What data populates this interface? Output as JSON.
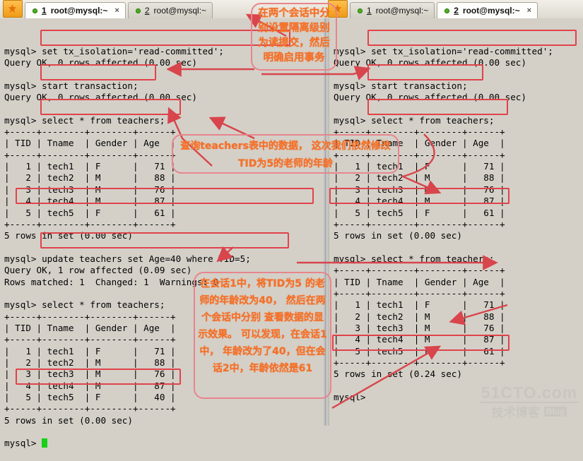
{
  "window": {
    "app_icon": "terminal-star-icon"
  },
  "tabs_left": [
    {
      "num": "1",
      "label": "root@mysql:~",
      "active": true,
      "close": "×"
    },
    {
      "num": "2",
      "label": "root@mysql:~",
      "active": false,
      "close": ""
    }
  ],
  "tabs_right": [
    {
      "num": "1",
      "label": "root@mysql:~",
      "active": false,
      "close": ""
    },
    {
      "num": "2",
      "label": "root@mysql:~",
      "active": true,
      "close": "×"
    }
  ],
  "session1": {
    "title": "session-1-terminal",
    "text": "mysql> set tx_isolation='read-committed';\nQuery OK, 0 rows affected (0.00 sec)\n\nmysql> start transaction;\nQuery OK, 0 rows affected (0.00 sec)\n\nmysql> select * from teachers;\n+-----+--------+--------+------+\n| TID | Tname  | Gender | Age  |\n+-----+--------+--------+------+\n|   1 | tech1  | F      |   71 |\n|   2 | tech2  | M      |   88 |\n|   3 | tech3  | M      |   76 |\n|   4 | tech4  | M      |   87 |\n|   5 | tech5  | F      |   61 |\n+-----+--------+--------+------+\n5 rows in set (0.00 sec)\n\nmysql> update teachers set Age=40 where TID=5;\nQuery OK, 1 row affected (0.09 sec)\nRows matched: 1  Changed: 1  Warnings: 0\n\nmysql> select * from teachers;\n+-----+--------+--------+------+\n| TID | Tname  | Gender | Age  |\n+-----+--------+--------+------+\n|   1 | tech1  | F      |   71 |\n|   2 | tech2  | M      |   88 |\n|   3 | tech3  | M      |   76 |\n|   4 | tech4  | M      |   87 |\n|   5 | tech5  | F      |   40 |\n+-----+--------+--------+------+\n5 rows in set (0.00 sec)\n\nmysql> ",
    "prompt_cursor": "green-block-cursor"
  },
  "session2": {
    "title": "session-2-terminal",
    "text": "mysql> set tx_isolation='read-committed';\nQuery OK, 0 rows affected (0.00 sec)\n\nmysql> start transaction;\nQuery OK, 0 rows affected (0.00 sec)\n\nmysql> select * from teachers;\n+-----+--------+--------+------+\n| TID | Tname  | Gender | Age  |\n+-----+--------+--------+------+\n|   1 | tech1  | F      |   71 |\n|   2 | tech2  | M      |   88 |\n|   3 | tech3  | M      |   76 |\n|   4 | tech4  | M      |   87 |\n|   5 | tech5  | F      |   61 |\n+-----+--------+--------+------+\n5 rows in set (0.00 sec)\n\nmysql> select * from teachers;\n+-----+--------+--------+------+\n| TID | Tname  | Gender | Age  |\n+-----+--------+--------+------+\n|   1 | tech1  | F      |   71 |\n|   2 | tech2  | M      |   88 |\n|   3 | tech3  | M      |   76 |\n|   4 | tech4  | M      |   87 |\n|   5 | tech5  | F      |   61 |\n+-----+--------+--------+------+\n5 rows in set (0.24 sec)\n\nmysql>"
  },
  "annotations": {
    "note1": "在两个会话中分\n别设置隔离级别\n为读提交，然后\n明确启用事务",
    "note2": "查询teachers表中的数据，\n这次我们依然修改TID为5的老师的年龄",
    "note3": "在会话1中，将TID为5\n的老师的年龄改为40，\n然后在两个会话中分别\n查看数据的显示效果。\n可以发现，在会话1中，\n年龄改为了40，但在会\n话2中，年龄依然是61",
    "highlight_color": "#e0434a",
    "note_text_color": "#f3712a"
  },
  "watermark": {
    "line1": "51CTO.com",
    "line2": "技术博客",
    "badge": "Blog"
  }
}
